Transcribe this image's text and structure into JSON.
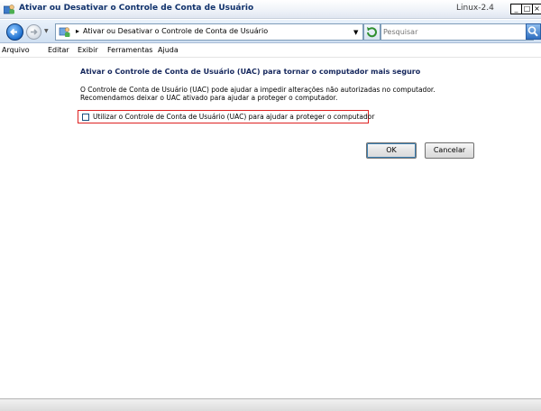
{
  "window": {
    "title": "Ativar ou Desativar o Controle de Conta de Usuário",
    "version_label": "Linux-2.4",
    "minimize_glyph": "_",
    "maximize_glyph": "□",
    "close_glyph": "×"
  },
  "address": {
    "path_separator": "▸",
    "path": "Ativar ou Desativar o Controle de Conta de Usuário",
    "search_placeholder": "Pesquisar"
  },
  "menu": {
    "items": [
      "Arquivo",
      "Editar",
      "Exibir",
      "Ferramentas",
      "Ajuda"
    ]
  },
  "content": {
    "heading": "Ativar o Controle de Conta de Usuário (UAC) para tornar o computador mais seguro",
    "description_line1": "O Controle de Conta de Usuário (UAC) pode ajudar a impedir alterações não autorizadas no computador.",
    "description_line2": "Recomendamos deixar o UAC ativado para ajudar a proteger o computador.",
    "option_label": "Utilizar o Controle de Conta de Usuário (UAC) para ajudar a proteger o computador",
    "option_checked": false
  },
  "buttons": {
    "ok": "OK",
    "cancel": "Cancelar"
  },
  "colors": {
    "heading": "#14265c",
    "highlight_border": "#dd2222",
    "title_text": "#10316b"
  }
}
